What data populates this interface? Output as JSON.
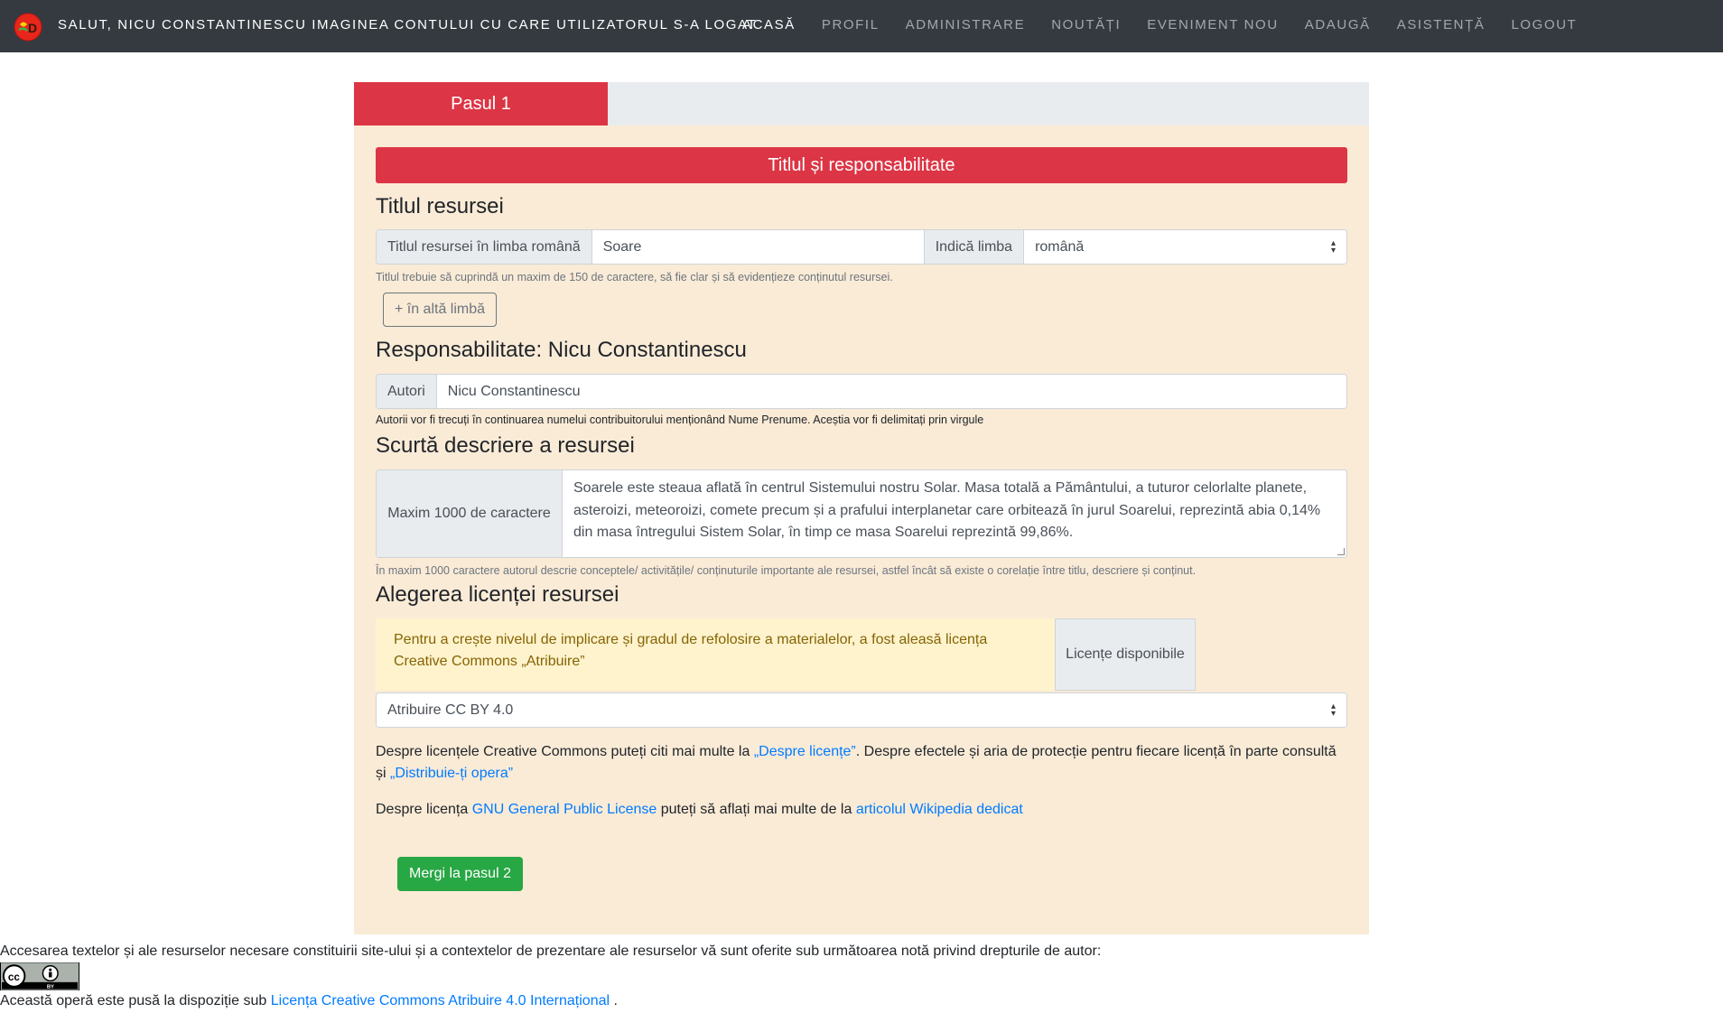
{
  "navbar": {
    "greeting": "Salut, Nicu Constantinescu Imaginea contului cu care utilizatorul s-a logat",
    "links": [
      {
        "label": "Acasă",
        "active": true
      },
      {
        "label": "Profil",
        "active": false
      },
      {
        "label": "Administrare",
        "active": false
      },
      {
        "label": "Noutăți",
        "active": false
      },
      {
        "label": "Eveniment nou",
        "active": false
      },
      {
        "label": "Adaugă",
        "active": false
      },
      {
        "label": "Asistență",
        "active": false
      },
      {
        "label": "Logout",
        "active": false
      }
    ]
  },
  "steps": {
    "active_step": "Pasul 1"
  },
  "form": {
    "section_title": "Titlul și responsabilitate",
    "title_heading": "Titlul resursei",
    "title_label": "Titlul resursei în limba română",
    "title_value": "Soare",
    "lang_label": "Indică limba",
    "lang_value": "română",
    "title_help": "Titlul trebuie să cuprindă un maxim de 150 de caractere, să fie clar și să evidențieze conținutul resursei.",
    "add_lang_button": "+ în altă limbă",
    "resp_heading": "Responsabilitate: Nicu Constantinescu",
    "authors_label": "Autori",
    "authors_value": "Nicu Constantinescu",
    "authors_help": "Autorii vor fi trecuți în continuarea numelui contribuitorului menționând Nume Prenume. Aceștia vor fi delimitați prin virgule",
    "desc_heading": "Scurtă descriere a resursei",
    "desc_label": "Maxim 1000 de caractere",
    "desc_value": "Soarele este steaua aflată în centrul Sistemului nostru Solar. Masa totală a Pământului, a tuturor celorlalte planete, asteroizi, meteoroizi, comete precum și a prafului interplanetar care orbitează în jurul Soarelui, reprezintă abia 0,14% din masa întregului Sistem Solar, în timp ce masa Soarelui reprezintă 99,86%.",
    "desc_help": "În maxim 1000 caractere autorul descrie conceptele/ activitățile/ conținuturile importante ale resursei, astfel încât să existe o corelație între titlu, descriere și conținut.",
    "license_heading": "Alegerea licenței resursei",
    "license_alert": "Pentru a crește nivelul de implicare și gradul de refolosire a materialelor, a fost aleasă licența Creative Commons „Atribuire”",
    "license_addon": "Licențe disponibile",
    "license_value": "Atribuire CC BY 4.0",
    "info1_text_a": "Despre licențele Creative Commons puteți citi mai multe la ",
    "info1_link_a": "„Despre licențe”",
    "info1_text_b": ". Despre efectele și aria de protecție pentru fiecare licență în parte consultă și ",
    "info1_link_b": "„Distribuie-ți opera”",
    "info2_text_a": "Despre licența ",
    "info2_link_a": "GNU General Public License",
    "info2_text_b": " puteți să aflați mai multe de la ",
    "info2_link_b": "articolul Wikipedia dedicat",
    "next_button": "Mergi la pasul 2"
  },
  "footer": {
    "notice": "Accesarea textelor și ale resurselor necesare constituirii site-ului și a contextelor de prezentare ale resurselor vă sunt oferite sub următoarea notă privind drepturile de autor:",
    "license_text": "Această operă este pusă la dispoziție sub ",
    "license_link": "Licența Creative Commons Atribuire 4.0 Internațional",
    "license_end": " ."
  },
  "colors": {
    "navbar": "#343a40",
    "danger": "#dc3545",
    "panel": "#faebd7",
    "success": "#28a745",
    "link": "#007bff"
  },
  "icons": [
    "site-logo-icon",
    "select-caret-icon",
    "resize-grip-icon",
    "cc-by-badge-icon"
  ]
}
